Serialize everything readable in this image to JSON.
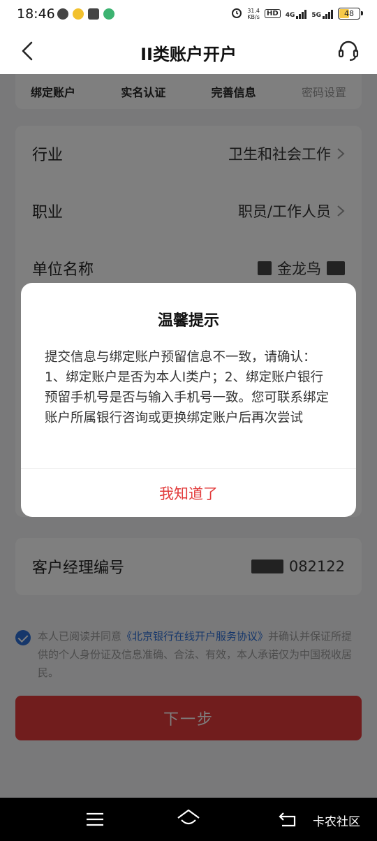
{
  "status_bar": {
    "time": "18:46",
    "net_speed_value": "31.4",
    "net_speed_unit": "KB/s",
    "hd_badge": "HD",
    "network_4g": "4G",
    "network_5g": "5G",
    "battery": "48"
  },
  "nav": {
    "title": "II类账户开户"
  },
  "steps": [
    "绑定账户",
    "实名认证",
    "完善信息",
    "密码设置"
  ],
  "form": {
    "industry": {
      "label": "行业",
      "value": "卫生和社会工作"
    },
    "occupation": {
      "label": "职业",
      "value": "职员/工作人员"
    },
    "company": {
      "label": "单位名称",
      "value_partial": "金龙鸟"
    }
  },
  "manager": {
    "label": "客户经理编号",
    "value_partial": "082122"
  },
  "agreement": {
    "prefix": "本人已阅读并同意",
    "link": "《北京银行在线开户服务协议》",
    "suffix": "并确认并保证所提供的个人身份证及信息准确、合法、有效，本人承诺仅为中国税收居民。"
  },
  "next_button": "下一步",
  "dialog": {
    "title": "温馨提示",
    "message": "提交信息与绑定账户预留信息不一致，请确认：1、绑定账户是否为本人I类户；2、绑定账户银行预留手机号是否与输入手机号一致。您可联系绑定账户所属银行咨询或更换绑定账户后再次尝试",
    "confirm": "我知道了"
  },
  "watermark": "卡农社区",
  "colors": {
    "accent_red": "#e23b3b",
    "link_blue": "#2d6fd6"
  }
}
